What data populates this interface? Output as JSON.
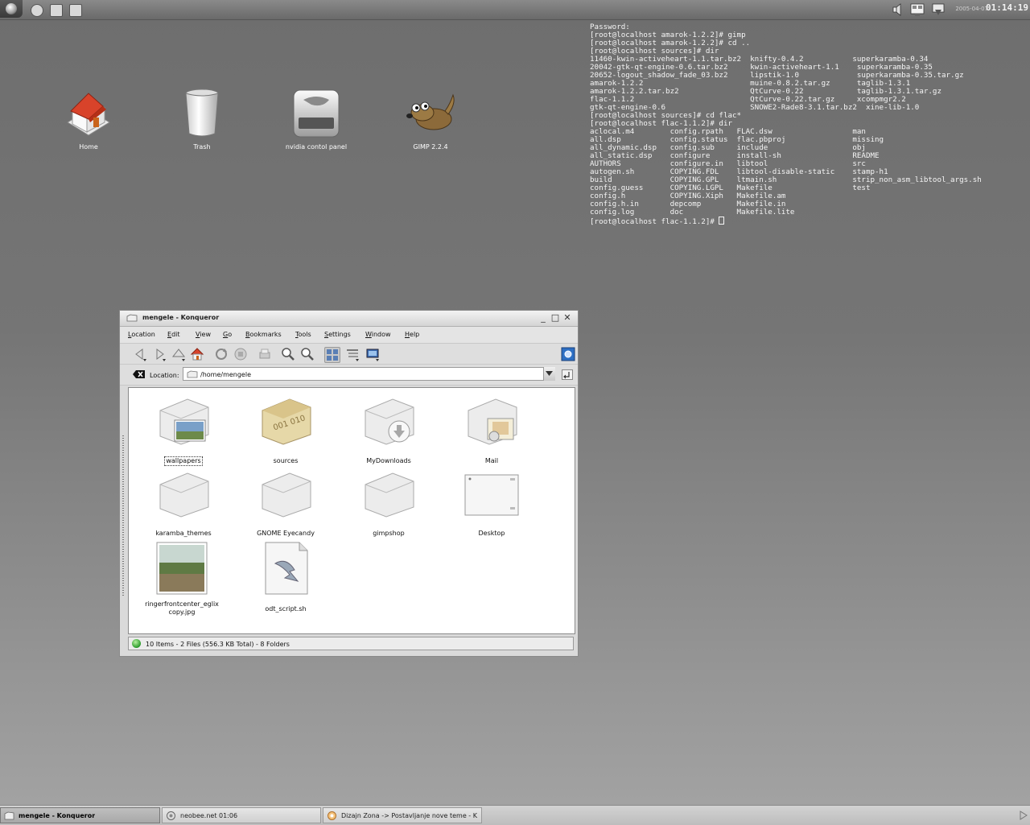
{
  "top_panel": {
    "date": "2005-04-07",
    "clock": "01:14:19"
  },
  "desktop_icons": [
    {
      "label": "Home",
      "icon": "home-icon"
    },
    {
      "label": "Trash",
      "icon": "trash-icon"
    },
    {
      "label": "nvidia contol panel",
      "icon": "nvidia-icon"
    },
    {
      "label": "GIMP 2.2.4",
      "icon": "gimp-icon"
    }
  ],
  "terminal": {
    "lines": [
      "Password:",
      "[root@localhost amarok-1.2.2]# gimp",
      "[root@localhost amarok-1.2.2]# cd ..",
      "[root@localhost sources]# dir",
      "11460-kwin-activeheart-1.1.tar.bz2  knifty-0.4.2           superkaramba-0.34",
      "20042-gtk-qt-engine-0.6.tar.bz2     kwin-activeheart-1.1    superkaramba-0.35",
      "20652-logout_shadow_fade_03.bz2     lipstik-1.0             superkaramba-0.35.tar.gz",
      "amarok-1.2.2                        muine-0.8.2.tar.gz      taglib-1.3.1",
      "amarok-1.2.2.tar.bz2                QtCurve-0.22            taglib-1.3.1.tar.gz",
      "flac-1.1.2                          QtCurve-0.22.tar.gz     xcompmgr2.2",
      "gtk-qt-engine-0.6                   SNOWE2-Rade8-3.1.tar.bz2  xine-lib-1.0",
      "[root@localhost sources]# cd flac*",
      "[root@localhost flac-1.1.2]# dir",
      "aclocal.m4        config.rpath   FLAC.dsw                  man",
      "all.dsp           config.status  flac.pbproj               missing",
      "all_dynamic.dsp   config.sub     include                   obj",
      "all_static.dsp    configure      install-sh                README",
      "AUTHORS           configure.in   libtool                   src",
      "autogen.sh        COPYING.FDL    libtool-disable-static    stamp-h1",
      "build             COPYING.GPL    ltmain.sh                 strip_non_asm_libtool_args.sh",
      "config.guess      COPYING.LGPL   Makefile                  test",
      "config.h          COPYING.Xiph   Makefile.am",
      "config.h.in       depcomp        Makefile.in",
      "config.log        doc            Makefile.lite"
    ],
    "prompt": "[root@localhost flac-1.1.2]# "
  },
  "konqueror": {
    "title": "mengele - Konqueror",
    "menu": [
      "Location",
      "Edit",
      "View",
      "Go",
      "Bookmarks",
      "Tools",
      "Settings",
      "Window",
      "Help"
    ],
    "location_label": "Location:",
    "location_value": "/home/mengele",
    "files": [
      {
        "label": "wallpapers",
        "icon": "folder-wallpapers-icon",
        "selected": true
      },
      {
        "label": "sources",
        "icon": "folder-sources-icon"
      },
      {
        "label": "MyDownloads",
        "icon": "folder-downloads-icon"
      },
      {
        "label": "Mail",
        "icon": "folder-mail-icon"
      },
      {
        "label": "karamba_themes",
        "icon": "folder-icon"
      },
      {
        "label": "GNOME Eyecandy",
        "icon": "folder-icon"
      },
      {
        "label": "gimpshop",
        "icon": "folder-icon"
      },
      {
        "label": "Desktop",
        "icon": "folder-desktop-icon"
      },
      {
        "label": "ringerfrontcenter_eglix copy.jpg",
        "icon": "image-file-icon"
      },
      {
        "label": "odt_script.sh",
        "icon": "script-file-icon"
      }
    ],
    "status": "10 Items - 2 Files (556.3 KB Total) - 8 Folders"
  },
  "taskbar": {
    "tasks": [
      {
        "label": "mengele - Konqueror",
        "active": true
      },
      {
        "label": "neobee.net 01:06",
        "active": false
      },
      {
        "label": "Dizajn Zona -> Postavljanje nove teme - K",
        "active": false
      }
    ]
  }
}
